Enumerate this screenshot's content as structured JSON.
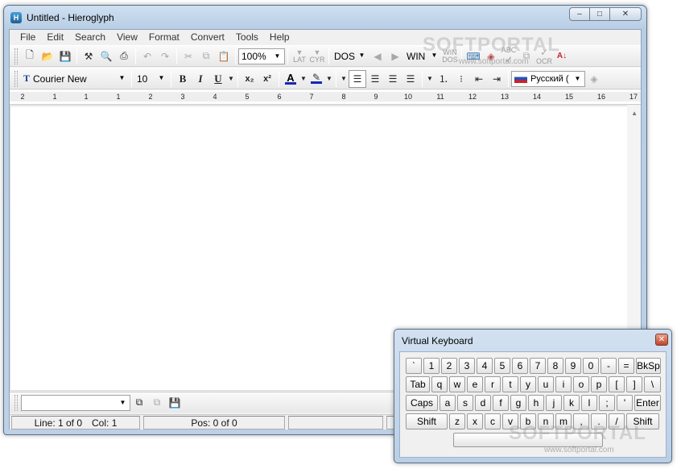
{
  "window": {
    "title": "Untitled - Hieroglyph",
    "app_icon": "hieroglyph-app-icon"
  },
  "controls": {
    "minimize": "–",
    "maximize": "□",
    "close": "✕"
  },
  "menu": [
    "File",
    "Edit",
    "Search",
    "View",
    "Format",
    "Convert",
    "Tools",
    "Help"
  ],
  "toolbar1": {
    "zoom": "100%",
    "lat_label": "LAT",
    "cyr_label": "CYR",
    "encoding_from": "DOS",
    "encoding_to": "WIN",
    "ocr_label": "OCR",
    "abc_label": "ABC",
    "win_label": "WIN",
    "dos_label": "DOS"
  },
  "toolbar2": {
    "font_name": "Courier New",
    "font_size": "10",
    "bold": "B",
    "italic": "I",
    "underline": "U",
    "subscript": "x₂",
    "superscript": "x²",
    "font_color": "A",
    "language": "Русский ("
  },
  "ruler": {
    "labels": [
      "2",
      "1",
      "1",
      "1",
      "2",
      "3",
      "4",
      "5",
      "6",
      "7",
      "8",
      "9",
      "10",
      "11",
      "12",
      "13",
      "14",
      "15",
      "16",
      "17"
    ]
  },
  "status": {
    "line": "Line: 1 of 0",
    "col": "Col: 1",
    "pos": "Pos: 0 of 0"
  },
  "virtual_keyboard": {
    "title": "Virtual Keyboard",
    "row1": [
      "`",
      "1",
      "2",
      "3",
      "4",
      "5",
      "6",
      "7",
      "8",
      "9",
      "0",
      "-",
      "=",
      "BkSp"
    ],
    "row2": [
      "Tab",
      "q",
      "w",
      "e",
      "r",
      "t",
      "y",
      "u",
      "i",
      "o",
      "p",
      "[",
      "]",
      "\\"
    ],
    "row3": [
      "Caps",
      "a",
      "s",
      "d",
      "f",
      "g",
      "h",
      "j",
      "k",
      "l",
      ";",
      "'",
      "Enter"
    ],
    "row4": [
      "Shift",
      "z",
      "x",
      "c",
      "v",
      "b",
      "n",
      "m",
      ",",
      ".",
      "/",
      "Shift"
    ]
  },
  "watermark": {
    "brand": "SOFTPORTAL",
    "url": "www.softportal.com"
  }
}
